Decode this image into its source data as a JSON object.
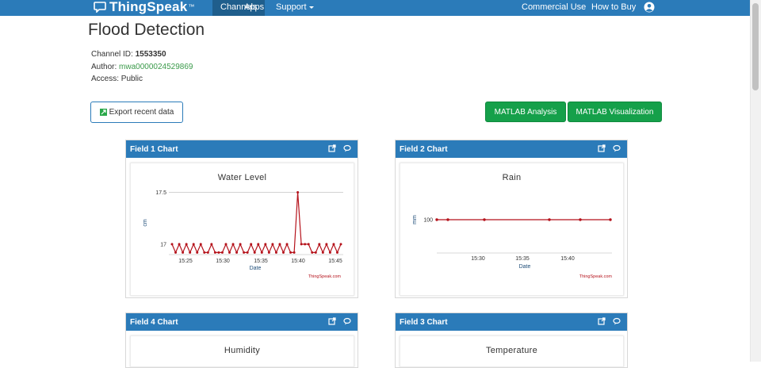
{
  "nav": {
    "brand": "ThingSpeak",
    "brand_tm": "™",
    "items": [
      {
        "label": "Channels",
        "active": true
      },
      {
        "label": "Apps"
      },
      {
        "label": "Support"
      }
    ],
    "right_items": [
      {
        "label": "Commercial Use"
      },
      {
        "label": "How to Buy"
      }
    ],
    "user_icon": "user-circle-icon"
  },
  "channel": {
    "title": "Flood Detection",
    "id_label": "Channel ID:",
    "id_value": "1553350",
    "author_label": "Author:",
    "author_value": "mwa0000024529869",
    "access_label": "Access:",
    "access_value": "Public"
  },
  "buttons": {
    "export": "Export recent data",
    "matlab_analysis": "MATLAB Analysis",
    "matlab_visualization": "MATLAB Visualization"
  },
  "panels": [
    {
      "header": "Field 1 Chart"
    },
    {
      "header": "Field 2 Chart"
    },
    {
      "header": "Field 4 Chart"
    },
    {
      "header": "Field 3 Chart"
    }
  ],
  "chart_data": [
    {
      "type": "line",
      "title": "Water Level",
      "xlabel": "Date",
      "ylabel": "cm",
      "x_ticks": [
        "15:25",
        "15:30",
        "15:35",
        "15:40",
        "15:45"
      ],
      "y_ticks": [
        "17",
        "17.5"
      ],
      "ylim": [
        16.9,
        17.55
      ],
      "credit": "ThingSpeak.com",
      "color": "#b5121b",
      "series": [
        {
          "values": [
            17,
            16.92,
            17,
            16.92,
            17,
            16.92,
            17,
            16.92,
            17,
            16.92,
            16.92,
            17,
            16.92,
            16.92,
            16.92,
            17,
            16.92,
            17,
            16.92,
            17,
            16.92,
            16.92,
            17,
            16.92,
            17,
            16.92,
            17,
            16.92,
            17,
            16.92,
            17,
            16.92,
            17,
            16.92,
            16.92,
            17.5,
            17,
            17,
            17,
            16.92,
            16.92,
            17,
            16.92,
            17,
            16.92,
            17,
            16.92,
            17
          ]
        }
      ]
    },
    {
      "type": "line",
      "title": "Rain",
      "xlabel": "Date",
      "ylabel": "mm",
      "x_ticks": [
        "15:30",
        "15:35",
        "15:40"
      ],
      "y_ticks": [
        "100"
      ],
      "credit": "ThingSpeak.com",
      "color": "#b5121b",
      "series": [
        {
          "values": [
            100,
            100,
            100,
            100,
            100,
            100
          ]
        }
      ]
    },
    {
      "type": "line",
      "title": "Humidity"
    },
    {
      "type": "line",
      "title": "Temperature"
    }
  ],
  "colors": {
    "nav": "#2b7bb9",
    "nav_active": "#1f5e8c",
    "green": "#15a04a",
    "series": "#b5121b"
  }
}
